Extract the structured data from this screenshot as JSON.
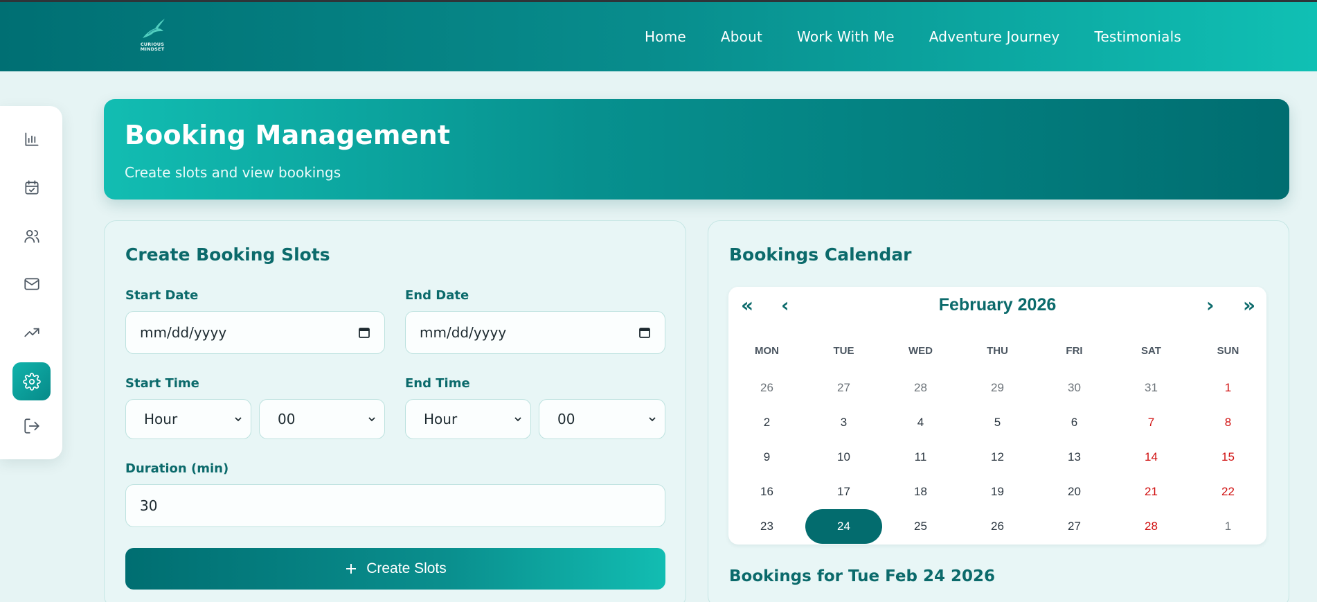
{
  "logo": {
    "line1": "CURIOUS",
    "line2": "MINDSET",
    "line3": "·····················"
  },
  "nav": [
    "Home",
    "About",
    "Work With Me",
    "Adventure Journey",
    "Testimonials"
  ],
  "rail": [
    {
      "icon": "bar-chart-icon"
    },
    {
      "icon": "calendar-check-icon"
    },
    {
      "icon": "users-icon"
    },
    {
      "icon": "mail-icon"
    },
    {
      "icon": "trending-up-icon"
    },
    {
      "icon": "gear-icon",
      "active": true
    },
    {
      "icon": "logout-icon"
    }
  ],
  "hero": {
    "title": "Booking Management",
    "subtitle": "Create slots and view bookings"
  },
  "form": {
    "title": "Create Booking Slots",
    "start_date_label": "Start Date",
    "end_date_label": "End Date",
    "start_date_placeholder": "mm/dd/yyyy",
    "end_date_placeholder": "mm/dd/yyyy",
    "start_time_label": "Start Time",
    "end_time_label": "End Time",
    "start_hour": "Hour",
    "start_minute": "00",
    "end_hour": "Hour",
    "end_minute": "00",
    "duration_label": "Duration (min)",
    "duration_value": "30",
    "create_button": "Create Slots"
  },
  "calendar": {
    "title": "Bookings Calendar",
    "month": "February 2026",
    "nav_prev_year": "«",
    "nav_prev": "‹",
    "nav_next": "›",
    "nav_next_year": "»",
    "weekdays": [
      "MON",
      "TUE",
      "WED",
      "THU",
      "FRI",
      "SAT",
      "SUN"
    ],
    "weeks": [
      [
        "26",
        "27",
        "28",
        "29",
        "30",
        "31",
        "1"
      ],
      [
        "2",
        "3",
        "4",
        "5",
        "6",
        "7",
        "8"
      ],
      [
        "9",
        "10",
        "11",
        "12",
        "13",
        "14",
        "15"
      ],
      [
        "16",
        "17",
        "18",
        "19",
        "20",
        "21",
        "22"
      ],
      [
        "23",
        "24",
        "25",
        "26",
        "27",
        "28",
        "1"
      ]
    ],
    "selected": "24",
    "bookings_for": "Bookings for Tue Feb 24 2026"
  },
  "colors": {
    "accent": "#0b6a6b",
    "weekend": "#d00f0f",
    "selected": "#036c6e"
  }
}
